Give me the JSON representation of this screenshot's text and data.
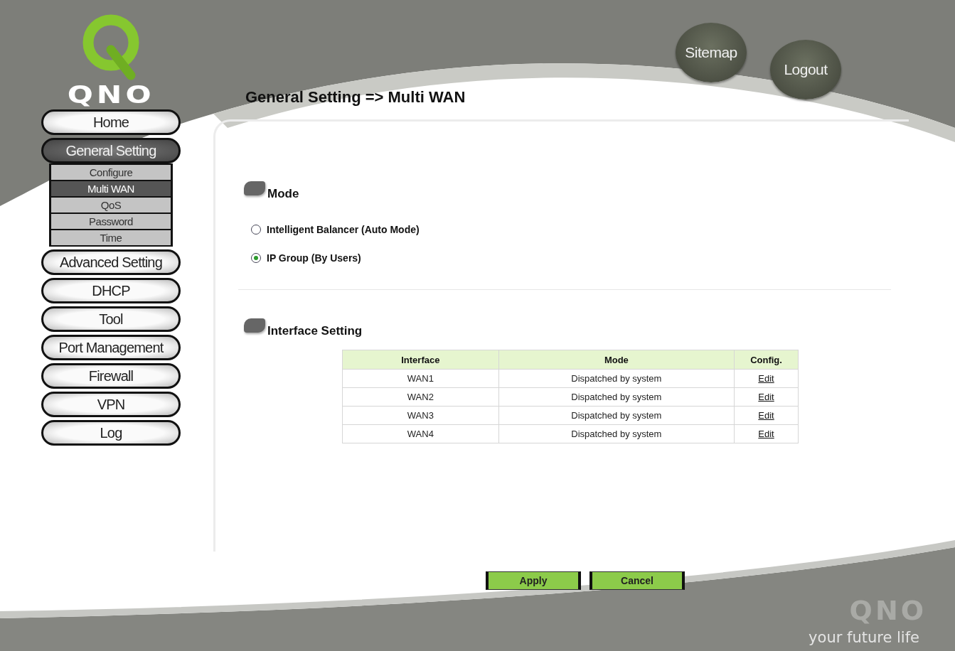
{
  "logo": {
    "text": "QNO"
  },
  "header_links": [
    {
      "label": "Sitemap"
    },
    {
      "label": "Logout"
    }
  ],
  "nav": [
    {
      "label": "Home",
      "selected": false
    },
    {
      "label": "General Setting",
      "selected": true,
      "children": [
        {
          "label": "Configure",
          "selected": false
        },
        {
          "label": "Multi WAN",
          "selected": true
        },
        {
          "label": "QoS",
          "selected": false
        },
        {
          "label": "Password",
          "selected": false
        },
        {
          "label": "Time",
          "selected": false
        }
      ]
    },
    {
      "label": "Advanced Setting",
      "selected": false
    },
    {
      "label": "DHCP",
      "selected": false
    },
    {
      "label": "Tool",
      "selected": false
    },
    {
      "label": "Port Management",
      "selected": false
    },
    {
      "label": "Firewall",
      "selected": false
    },
    {
      "label": "VPN",
      "selected": false
    },
    {
      "label": "Log",
      "selected": false
    }
  ],
  "page_title": "General Setting => Multi WAN",
  "mode": {
    "title": "Mode",
    "options": [
      {
        "label": "Intelligent Balancer (Auto Mode)",
        "selected": false
      },
      {
        "label": "IP Group (By Users)",
        "selected": true
      }
    ]
  },
  "interface_setting": {
    "title": "Interface Setting",
    "table": {
      "columns": [
        "Interface",
        "Mode",
        "Config."
      ],
      "rows": [
        [
          "WAN1",
          "Dispatched by system",
          "Edit"
        ],
        [
          "WAN2",
          "Dispatched by system",
          "Edit"
        ],
        [
          "WAN3",
          "Dispatched by system",
          "Edit"
        ],
        [
          "WAN4",
          "Dispatched by system",
          "Edit"
        ]
      ]
    }
  },
  "buttons": [
    {
      "label": "Apply"
    },
    {
      "label": "Cancel"
    }
  ],
  "footer": {
    "logo": "QNO",
    "tagline": "your future life"
  }
}
